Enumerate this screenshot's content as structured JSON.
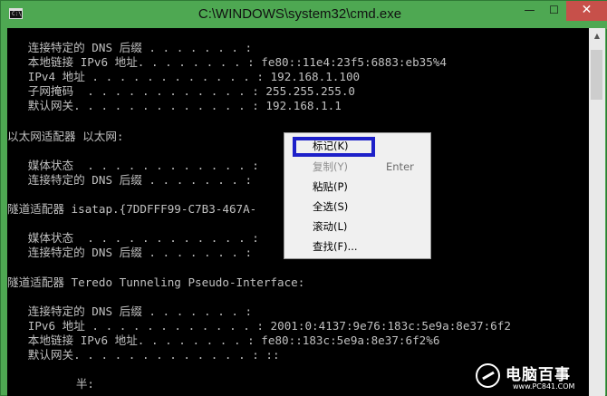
{
  "window": {
    "title": "C:\\WINDOWS\\system32\\cmd.exe",
    "icon_text": "C:\\",
    "minimize_glyph": "—",
    "maximize_glyph": "☐",
    "close_glyph": "✕"
  },
  "console": {
    "lines": [
      "   连接特定的 DNS 后缀 . . . . . . . :",
      "   本地链接 IPv6 地址. . . . . . . . : fe80::11e4:23f5:6883:eb35%4",
      "   IPv4 地址 . . . . . . . . . . . . : 192.168.1.100",
      "   子网掩码  . . . . . . . . . . . . : 255.255.255.0",
      "   默认网关. . . . . . . . . . . . . : 192.168.1.1",
      "",
      "以太网适配器 以太网:",
      "",
      "   媒体状态  . . . . . . . . . . . . :",
      "   连接特定的 DNS 后缀 . . . . . . . :",
      "",
      "隧道适配器 isatap.{7DDFFF99-C7B3-467A-",
      "",
      "   媒体状态  . . . . . . . . . . . . :",
      "   连接特定的 DNS 后缀 . . . . . . . :",
      "",
      "隧道适配器 Teredo Tunneling Pseudo-Interface:",
      "",
      "   连接特定的 DNS 后缀 . . . . . . . :",
      "   IPv6 地址 . . . . . . . . . . . . : 2001:0:4137:9e76:183c:5e9a:8e37:6f2",
      "   本地链接 IPv6 地址. . . . . . . . : fe80::183c:5e9a:8e37:6f2%6",
      "   默认网关. . . . . . . . . . . . . : ::",
      "",
      "          半:"
    ]
  },
  "context_menu": {
    "items": [
      {
        "label": "标记(K)",
        "accel": "",
        "disabled": false
      },
      {
        "label": "复制(Y)",
        "accel": "Enter",
        "disabled": true
      },
      {
        "label": "粘贴(P)",
        "accel": "",
        "disabled": false
      },
      {
        "label": "全选(S)",
        "accel": "",
        "disabled": false
      },
      {
        "label": "滚动(L)",
        "accel": "",
        "disabled": false
      },
      {
        "label": "查找(F)...",
        "accel": "",
        "disabled": false
      }
    ]
  },
  "watermark": {
    "brand": "电脑百事",
    "url": "www.PC841.COM"
  },
  "colors": {
    "titlebar": "#4ea852",
    "close": "#c7504a",
    "console_bg": "#000000",
    "console_text": "#c0c0c0",
    "highlight": "#1d20c9"
  }
}
